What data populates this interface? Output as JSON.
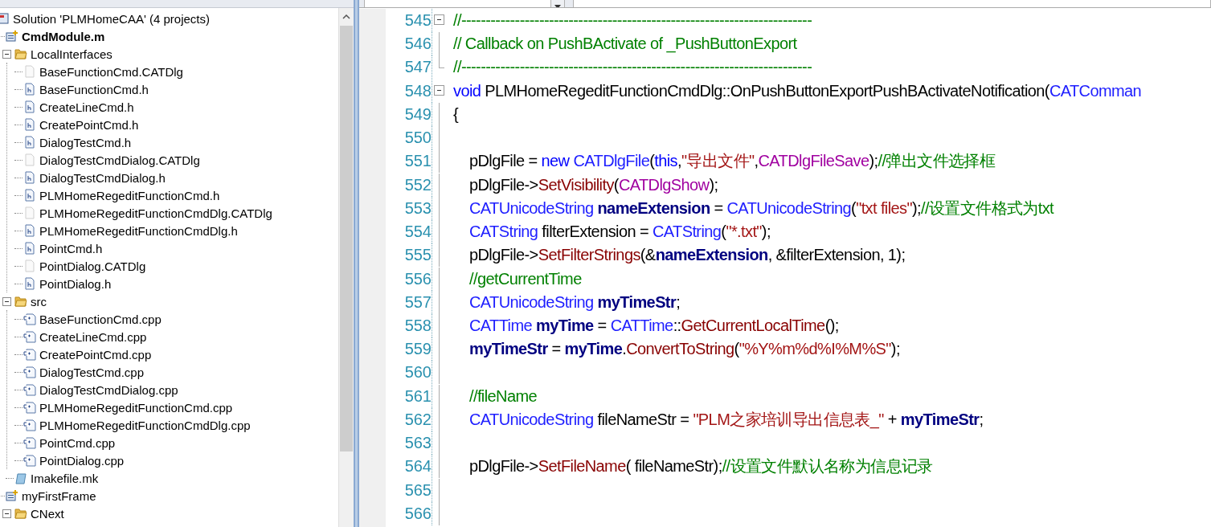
{
  "solution_explorer": {
    "tree": [
      {
        "label": "Solution 'PLMHomeCAA' (4 projects)",
        "kind": "solution",
        "children": [
          {
            "label": "CmdModule.m",
            "kind": "project",
            "startup": true,
            "children": [
              {
                "label": "LocalInterfaces",
                "kind": "folder",
                "expanded": true,
                "children": [
                  {
                    "label": "BaseFunctionCmd.CATDlg",
                    "kind": "dialog"
                  },
                  {
                    "label": "BaseFunctionCmd.h",
                    "kind": "header"
                  },
                  {
                    "label": "CreateLineCmd.h",
                    "kind": "header"
                  },
                  {
                    "label": "CreatePointCmd.h",
                    "kind": "header"
                  },
                  {
                    "label": "DialogTestCmd.h",
                    "kind": "header"
                  },
                  {
                    "label": "DialogTestCmdDialog.CATDlg",
                    "kind": "dialog"
                  },
                  {
                    "label": "DialogTestCmdDialog.h",
                    "kind": "header"
                  },
                  {
                    "label": "PLMHomeRegeditFunctionCmd.h",
                    "kind": "header"
                  },
                  {
                    "label": "PLMHomeRegeditFunctionCmdDlg.CATDlg",
                    "kind": "dialog"
                  },
                  {
                    "label": "PLMHomeRegeditFunctionCmdDlg.h",
                    "kind": "header"
                  },
                  {
                    "label": "PointCmd.h",
                    "kind": "header"
                  },
                  {
                    "label": "PointDialog.CATDlg",
                    "kind": "dialog"
                  },
                  {
                    "label": "PointDialog.h",
                    "kind": "header"
                  }
                ]
              },
              {
                "label": "src",
                "kind": "folder",
                "expanded": true,
                "children": [
                  {
                    "label": "BaseFunctionCmd.cpp",
                    "kind": "cpp"
                  },
                  {
                    "label": "CreateLineCmd.cpp",
                    "kind": "cpp"
                  },
                  {
                    "label": "CreatePointCmd.cpp",
                    "kind": "cpp"
                  },
                  {
                    "label": "DialogTestCmd.cpp",
                    "kind": "cpp"
                  },
                  {
                    "label": "DialogTestCmdDialog.cpp",
                    "kind": "cpp"
                  },
                  {
                    "label": "PLMHomeRegeditFunctionCmd.cpp",
                    "kind": "cpp"
                  },
                  {
                    "label": "PLMHomeRegeditFunctionCmdDlg.cpp",
                    "kind": "cpp"
                  },
                  {
                    "label": "PointCmd.cpp",
                    "kind": "cpp"
                  },
                  {
                    "label": "PointDialog.cpp",
                    "kind": "cpp"
                  }
                ]
              },
              {
                "label": "Imakefile.mk",
                "kind": "makefile"
              }
            ]
          },
          {
            "label": "myFirstFrame",
            "kind": "project",
            "startup": false,
            "children": [
              {
                "label": "CNext",
                "kind": "folder",
                "expanded": true
              }
            ]
          }
        ]
      }
    ]
  },
  "editor": {
    "lines": [
      {
        "number": "545",
        "collapsible": true,
        "indented": false,
        "tokens": [
          {
            "kind": "comment",
            "text": "//------------------------------------------------------------------------"
          }
        ]
      },
      {
        "number": "546",
        "collapsible": false,
        "indented": false,
        "tokens": [
          {
            "kind": "comment",
            "text": "// Callback on PushBActivate of _PushButtonExport"
          }
        ]
      },
      {
        "number": "547",
        "collapsible": false,
        "indented": false,
        "tokens": [
          {
            "kind": "comment",
            "text": "//------------------------------------------------------------------------"
          }
        ]
      },
      {
        "number": "548",
        "collapsible": true,
        "indented": false,
        "tokens": [
          {
            "kind": "keyword",
            "text": "void"
          },
          {
            "kind": "plain",
            "text": " PLMHomeRegeditFunctionCmdDlg::OnPushButtonExportPushBActivateNotification("
          },
          {
            "kind": "type",
            "text": "CATComman"
          }
        ]
      },
      {
        "number": "549",
        "collapsible": false,
        "indented": false,
        "tokens": [
          {
            "kind": "plain",
            "text": "{"
          }
        ]
      },
      {
        "number": "550",
        "collapsible": false
      },
      {
        "number": "551",
        "collapsible": false,
        "indented": true,
        "tokens": [
          {
            "kind": "plain",
            "text": "pDlgFile = "
          },
          {
            "kind": "keyword",
            "text": "new"
          },
          {
            "kind": "type",
            "text": " CATDlgFile"
          },
          {
            "kind": "plain",
            "text": "("
          },
          {
            "kind": "keyword",
            "text": "this"
          },
          {
            "kind": "plain",
            "text": ","
          },
          {
            "kind": "string",
            "text": "\"导出文件\""
          },
          {
            "kind": "plain",
            "text": ","
          },
          {
            "kind": "macro",
            "text": "CATDlgFileSave"
          },
          {
            "kind": "plain",
            "text": ");"
          },
          {
            "kind": "comment",
            "text": "//弹出文件选择框"
          }
        ]
      },
      {
        "number": "552",
        "collapsible": false,
        "indented": true,
        "tokens": [
          {
            "kind": "plain",
            "text": "pDlgFile->"
          },
          {
            "kind": "function",
            "text": "SetVisibility"
          },
          {
            "kind": "plain",
            "text": "("
          },
          {
            "kind": "macro",
            "text": "CATDlgShow"
          },
          {
            "kind": "plain",
            "text": ");"
          }
        ]
      },
      {
        "number": "553",
        "collapsible": false,
        "indented": true,
        "tokens": [
          {
            "kind": "type",
            "text": "CATUnicodeString"
          },
          {
            "kind": "variable",
            "text": " nameExtension"
          },
          {
            "kind": "plain",
            "text": " = "
          },
          {
            "kind": "type",
            "text": "CATUnicodeString"
          },
          {
            "kind": "plain",
            "text": "("
          },
          {
            "kind": "string",
            "text": "\"txt files\""
          },
          {
            "kind": "plain",
            "text": ");"
          },
          {
            "kind": "comment",
            "text": "//设置文件格式为txt"
          }
        ]
      },
      {
        "number": "554",
        "collapsible": false,
        "indented": true,
        "tokens": [
          {
            "kind": "type",
            "text": "CATString"
          },
          {
            "kind": "plain",
            "text": " filterExtension = "
          },
          {
            "kind": "type",
            "text": "CATString"
          },
          {
            "kind": "plain",
            "text": "("
          },
          {
            "kind": "string",
            "text": "\"*.txt\""
          },
          {
            "kind": "plain",
            "text": ");"
          }
        ]
      },
      {
        "number": "555",
        "collapsible": false,
        "indented": true,
        "tokens": [
          {
            "kind": "plain",
            "text": "pDlgFile->"
          },
          {
            "kind": "function",
            "text": "SetFilterStrings"
          },
          {
            "kind": "plain",
            "text": "(&"
          },
          {
            "kind": "variable",
            "text": "nameExtension"
          },
          {
            "kind": "plain",
            "text": ", &filterExtension, 1);"
          }
        ]
      },
      {
        "number": "556",
        "collapsible": false,
        "indented": true,
        "tokens": [
          {
            "kind": "comment",
            "text": "//getCurrentTime"
          }
        ]
      },
      {
        "number": "557",
        "collapsible": false,
        "indented": true,
        "tokens": [
          {
            "kind": "type",
            "text": "CATUnicodeString"
          },
          {
            "kind": "variable",
            "text": " myTimeStr"
          },
          {
            "kind": "plain",
            "text": ";"
          }
        ]
      },
      {
        "number": "558",
        "collapsible": false,
        "indented": true,
        "tokens": [
          {
            "kind": "type",
            "text": "CATTime"
          },
          {
            "kind": "variable",
            "text": " myTime"
          },
          {
            "kind": "plain",
            "text": " = "
          },
          {
            "kind": "type",
            "text": "CATTime"
          },
          {
            "kind": "plain",
            "text": "::"
          },
          {
            "kind": "function",
            "text": "GetCurrentLocalTime"
          },
          {
            "kind": "plain",
            "text": "();"
          }
        ]
      },
      {
        "number": "559",
        "collapsible": false,
        "indented": true,
        "tokens": [
          {
            "kind": "variable",
            "text": "myTimeStr"
          },
          {
            "kind": "plain",
            "text": " = "
          },
          {
            "kind": "variable",
            "text": "myTime"
          },
          {
            "kind": "plain",
            "text": "."
          },
          {
            "kind": "function",
            "text": "ConvertToString"
          },
          {
            "kind": "plain",
            "text": "("
          },
          {
            "kind": "string",
            "text": "\"%Y%m%d%I%M%S\""
          },
          {
            "kind": "plain",
            "text": ");"
          }
        ]
      },
      {
        "number": "560",
        "collapsible": false
      },
      {
        "number": "561",
        "collapsible": false,
        "indented": true,
        "tokens": [
          {
            "kind": "comment",
            "text": "//fileName"
          }
        ]
      },
      {
        "number": "562",
        "collapsible": false,
        "indented": true,
        "tokens": [
          {
            "kind": "type",
            "text": "CATUnicodeString"
          },
          {
            "kind": "plain",
            "text": " fileNameStr = "
          },
          {
            "kind": "string",
            "text": "\"PLM之家培训导出信息表_\""
          },
          {
            "kind": "plain",
            "text": " + "
          },
          {
            "kind": "variable",
            "text": "myTimeStr"
          },
          {
            "kind": "plain",
            "text": ";"
          }
        ]
      },
      {
        "number": "563",
        "collapsible": false
      },
      {
        "number": "564",
        "collapsible": false,
        "indented": true,
        "tokens": [
          {
            "kind": "plain",
            "text": "pDlgFile->"
          },
          {
            "kind": "function",
            "text": "SetFileName"
          },
          {
            "kind": "plain",
            "text": "( fileNameStr);"
          },
          {
            "kind": "comment",
            "text": "//设置文件默认名称为信息记录"
          }
        ]
      },
      {
        "number": "565",
        "collapsible": false
      },
      {
        "number": "566",
        "collapsible": false
      }
    ]
  }
}
